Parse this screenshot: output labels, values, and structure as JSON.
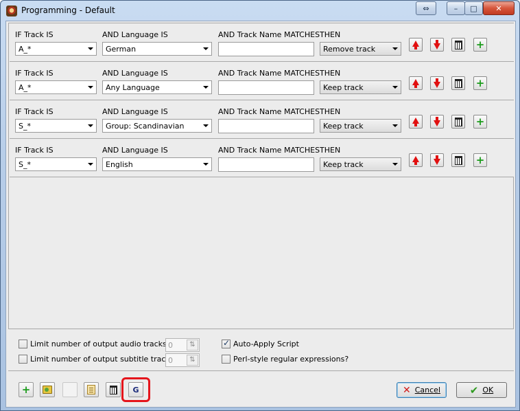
{
  "window": {
    "title": "Programming - Default",
    "controls": {
      "restore_glyph": "⇔",
      "minimize_glyph": "–",
      "maximize_glyph": "□",
      "close_glyph": "✕"
    }
  },
  "columns": {
    "track": "IF Track IS",
    "language": "AND Language IS",
    "name": "AND Track Name MATCHES",
    "then": "THEN"
  },
  "rules": [
    {
      "track": "A_*",
      "language": "German",
      "name": "",
      "action": "Remove track"
    },
    {
      "track": "A_*",
      "language": "Any Language",
      "name": "",
      "action": "Keep track"
    },
    {
      "track": "S_*",
      "language": "Group: Scandinavian",
      "name": "",
      "action": "Keep track"
    },
    {
      "track": "S_*",
      "language": "English",
      "name": "",
      "action": "Keep track"
    }
  ],
  "options": {
    "limit_audio": {
      "label": "Limit number of output audio tracks:",
      "checked": false,
      "value": "0"
    },
    "limit_subtitle": {
      "label": "Limit number of output subtitle tracks:",
      "checked": false,
      "value": "0"
    },
    "auto_apply": {
      "label": "Auto-Apply Script",
      "checked": true
    },
    "perl_regex": {
      "label": "Perl-style regular expressions?",
      "checked": false
    }
  },
  "footer": {
    "g_button": "G",
    "cancel": {
      "text": "Cancel"
    },
    "ok": {
      "text": "OK"
    }
  },
  "colors": {
    "highlight": "#e5151c",
    "arrow": "#e11010",
    "plus": "#1a9b1a"
  }
}
